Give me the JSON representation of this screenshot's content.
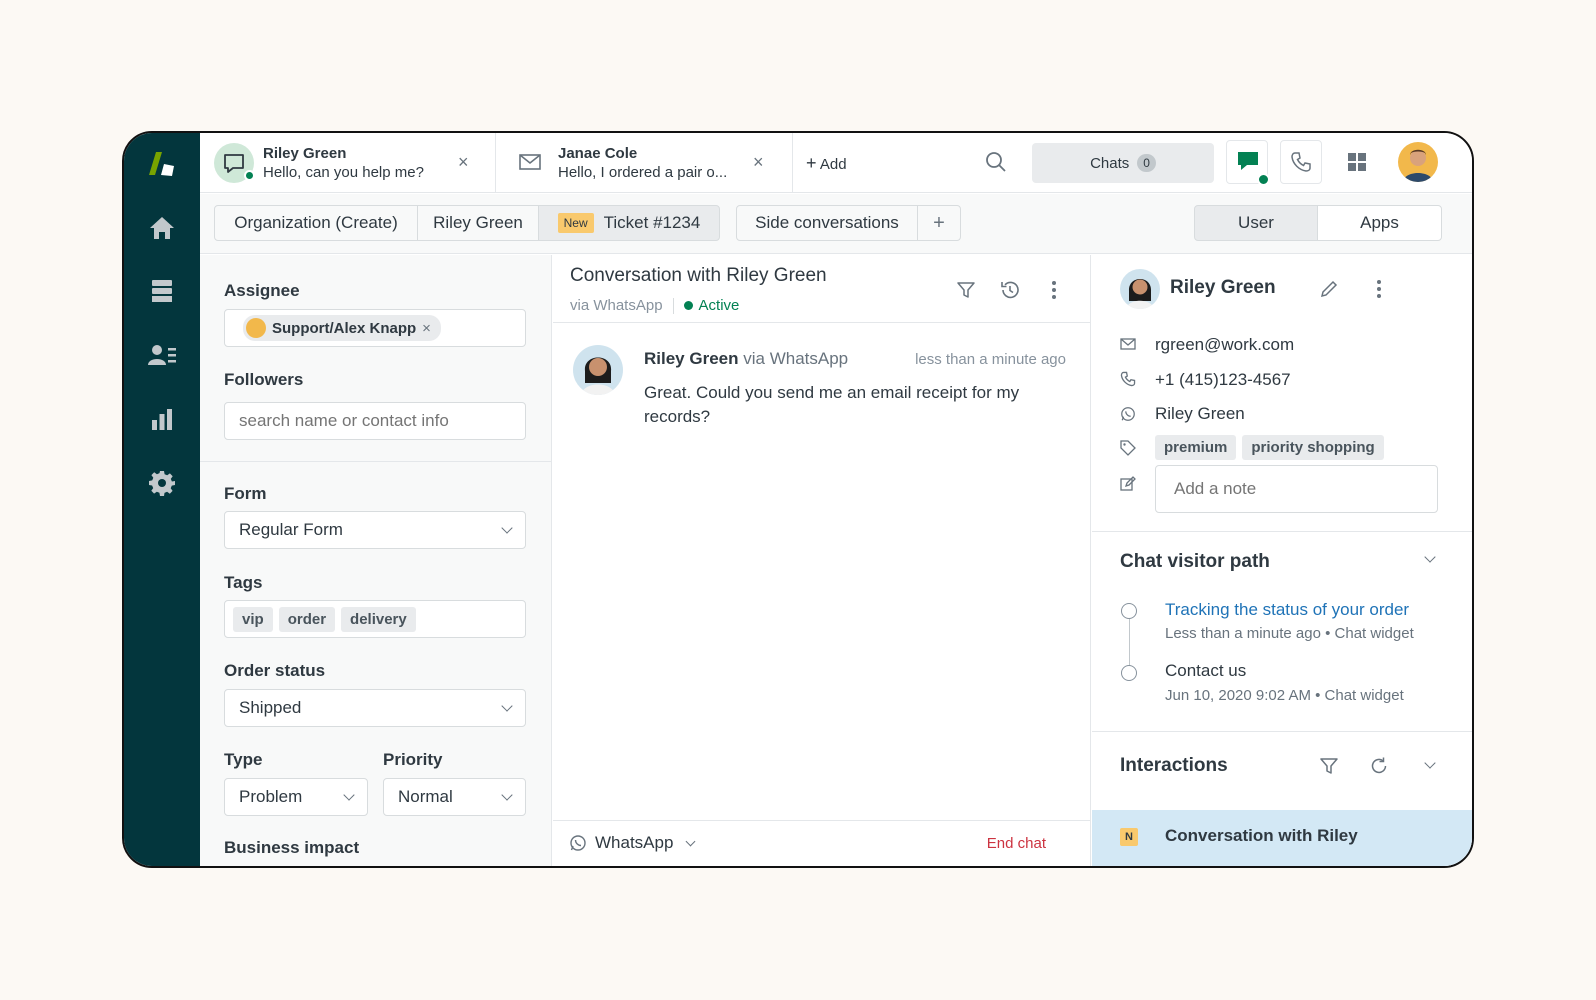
{
  "tabs": [
    {
      "name": "Riley Green",
      "preview": "Hello, can you help me?"
    },
    {
      "name": "Janae Cole",
      "preview": "Hello, I ordered a pair o..."
    }
  ],
  "topbar": {
    "add_label": "Add",
    "chats_label": "Chats",
    "chats_count": "0"
  },
  "subtabs": {
    "organization": "Organization (Create)",
    "requester": "Riley Green",
    "badge": "New",
    "ticket": "Ticket #1234",
    "side": "Side conversations",
    "plus": "+",
    "user": "User",
    "apps": "Apps"
  },
  "form": {
    "assignee_label": "Assignee",
    "assignee_value": "Support/Alex Knapp",
    "followers_label": "Followers",
    "followers_placeholder": "search name or contact info",
    "form_label": "Form",
    "form_value": "Regular Form",
    "tags_label": "Tags",
    "tags": [
      "vip",
      "order",
      "delivery"
    ],
    "order_status_label": "Order status",
    "order_status_value": "Shipped",
    "type_label": "Type",
    "type_value": "Problem",
    "priority_label": "Priority",
    "priority_value": "Normal",
    "business_impact_label": "Business impact"
  },
  "conversation": {
    "title": "Conversation with Riley Green",
    "channel": "via WhatsApp",
    "status": "Active",
    "message": {
      "author": "Riley Green",
      "via": "via WhatsApp",
      "time": "less than a minute ago",
      "text": "Great. Could you send me an email receipt for my records?"
    },
    "composer_channel": "WhatsApp",
    "end_chat": "End chat"
  },
  "user": {
    "name": "Riley Green",
    "email": "rgreen@work.com",
    "phone": "+1 (415)123-4567",
    "whatsapp": "Riley Green",
    "tags": [
      "premium",
      "priority shopping"
    ],
    "note_placeholder": "Add a note"
  },
  "visitor_path": {
    "title": "Chat visitor path",
    "items": [
      {
        "title": "Tracking the status of your order",
        "meta": "Less than a minute ago • Chat widget",
        "link": true
      },
      {
        "title": "Contact us",
        "meta": "Jun 10, 2020 9:02 AM • Chat widget",
        "link": false
      }
    ]
  },
  "interactions": {
    "title": "Interactions",
    "badge": "N",
    "item": "Conversation with Riley"
  },
  "colors": {
    "rail": "#03363d",
    "brand_green": "#78a300",
    "online_green": "#038153",
    "badge_yellow": "#f9c96d",
    "link_blue": "#1f73b7",
    "end_chat_red": "#cc3340",
    "highlight": "#d3e8f5"
  }
}
